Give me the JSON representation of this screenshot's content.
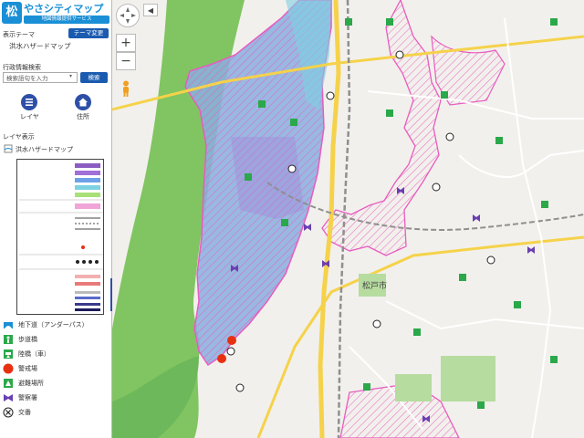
{
  "app": {
    "logo_mark": "松",
    "title": "やさシティマップ",
    "subtitle": "地図情報提供サービス"
  },
  "theme": {
    "label": "表示テーマ",
    "change_button": "テーマ変更",
    "current": "洪水ハザードマップ"
  },
  "search": {
    "label": "行政情報検索",
    "placeholder": "検索語句を入力",
    "button": "検索"
  },
  "toolbar": {
    "layer_label": "レイヤ",
    "home_label": "住所"
  },
  "layers": {
    "label": "レイヤ表示",
    "hazard_label": "洪水ハザードマップ",
    "facilities": [
      {
        "label": "地下道（アンダーパス）",
        "icon": "underpass-icon",
        "color": "#1a8fd6"
      },
      {
        "label": "歩道橋",
        "icon": "footbridge-icon",
        "color": "#2aa84a"
      },
      {
        "label": "陸橋（車）",
        "icon": "overpass-icon",
        "color": "#2aa84a"
      },
      {
        "label": "警戒場",
        "icon": "warning-spot-icon",
        "color": "#e83010"
      },
      {
        "label": "避難場所",
        "icon": "shelter-icon",
        "color": "#2aa84a"
      },
      {
        "label": "警察署",
        "icon": "police-icon",
        "color": "#6a3fb0"
      },
      {
        "label": "交番",
        "icon": "police-box-icon",
        "color": "#222222"
      }
    ]
  },
  "map": {
    "zoom_in": "+",
    "zoom_out": "−",
    "collapse": "◀",
    "city_label": "松戸市",
    "colors": {
      "flood": "#8aaee0",
      "flood_deep": "#7a9ad6",
      "boundary": "#e85cbf",
      "river": "#79c25a",
      "road_major": "#f5d24a",
      "rail": "#8f8f8f"
    }
  }
}
